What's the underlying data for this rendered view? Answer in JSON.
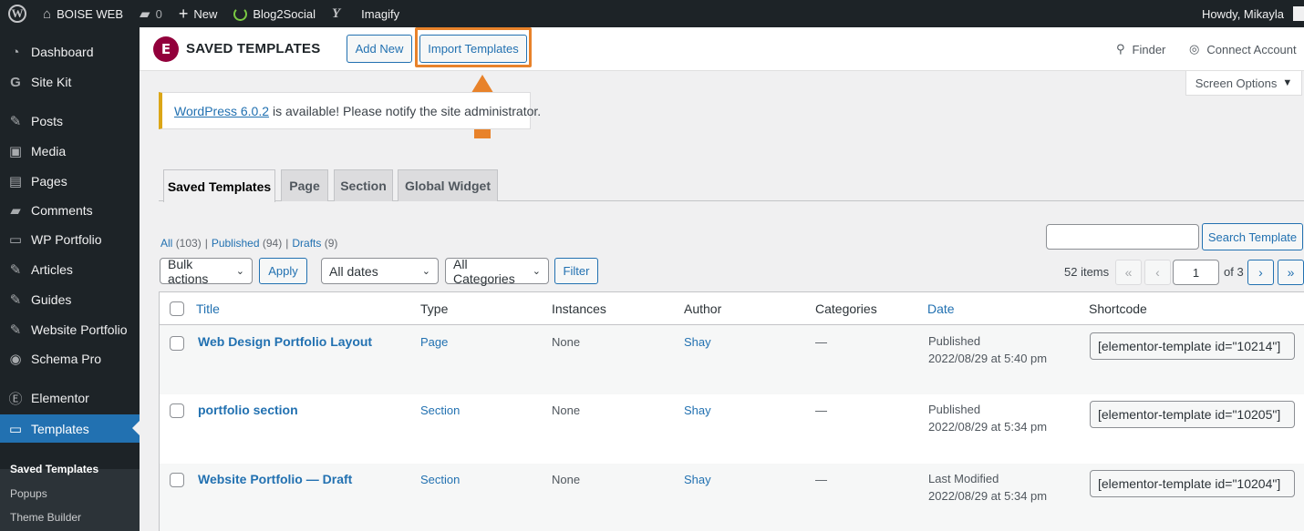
{
  "adminbar": {
    "site_name": "BOISE WEB",
    "comments_count": "0",
    "new_label": "New",
    "blog2social_label": "Blog2Social",
    "imagify_label": "Imagify",
    "howdy": "Howdy, Mikayla"
  },
  "sidebar": {
    "items": [
      {
        "label": "Dashboard",
        "icon": "dashboard-icon"
      },
      {
        "label": "Site Kit",
        "icon": "google-g-icon"
      },
      {
        "label": "Posts",
        "icon": "pin-icon"
      },
      {
        "label": "Media",
        "icon": "media-icon"
      },
      {
        "label": "Pages",
        "icon": "page-icon"
      },
      {
        "label": "Comments",
        "icon": "comment-icon"
      },
      {
        "label": "WP Portfolio",
        "icon": "folder-icon"
      },
      {
        "label": "Articles",
        "icon": "pin-icon"
      },
      {
        "label": "Guides",
        "icon": "pin-icon"
      },
      {
        "label": "Website Portfolio",
        "icon": "pin-icon"
      },
      {
        "label": "Schema Pro",
        "icon": "globe-icon"
      },
      {
        "label": "Elementor",
        "icon": "elementor-icon"
      },
      {
        "label": "Templates",
        "icon": "folder-icon"
      }
    ],
    "submenu": [
      "Saved Templates",
      "Popups",
      "Theme Builder"
    ]
  },
  "header": {
    "title": "SAVED TEMPLATES",
    "add_new": "Add New",
    "import_templates": "Import Templates",
    "finder": "Finder",
    "connect_account": "Connect Account",
    "highlight_color": "#e8822a"
  },
  "screen_options": "Screen Options",
  "notice": {
    "link": "WordPress 6.0.2",
    "text": "is available! Please notify the site administrator."
  },
  "tabs": [
    "Saved Templates",
    "Page",
    "Section",
    "Global Widget"
  ],
  "filters": {
    "all": "All",
    "all_count": "(103)",
    "published": "Published",
    "published_count": "(94)",
    "drafts": "Drafts",
    "drafts_count": "(9)",
    "bulk_actions": "Bulk actions",
    "apply": "Apply",
    "all_dates": "All dates",
    "all_categories": "All Categories",
    "filter": "Filter",
    "search_button": "Search Template"
  },
  "pagination": {
    "items": "52 items",
    "first": "«",
    "prev": "‹",
    "current": "1",
    "of": "of 3",
    "next": "›",
    "last": "»"
  },
  "table": {
    "columns": [
      "Title",
      "Type",
      "Instances",
      "Author",
      "Categories",
      "Date",
      "Shortcode"
    ],
    "rows": [
      {
        "title": "Web Design Portfolio Layout",
        "type": "Page",
        "instances": "None",
        "author": "Shay",
        "categories": "—",
        "status": "Published",
        "date": "2022/08/29 at 5:40 pm",
        "shortcode": "[elementor-template id=\"10214\"]"
      },
      {
        "title": "portfolio section",
        "type": "Section",
        "instances": "None",
        "author": "Shay",
        "categories": "—",
        "status": "Published",
        "date": "2022/08/29 at 5:34 pm",
        "shortcode": "[elementor-template id=\"10205\"]"
      },
      {
        "title": "Website Portfolio — Draft",
        "type": "Section",
        "instances": "None",
        "author": "Shay",
        "categories": "—",
        "status": "Last Modified",
        "date": "2022/08/29 at 5:34 pm",
        "shortcode": "[elementor-template id=\"10204\"]"
      }
    ]
  }
}
